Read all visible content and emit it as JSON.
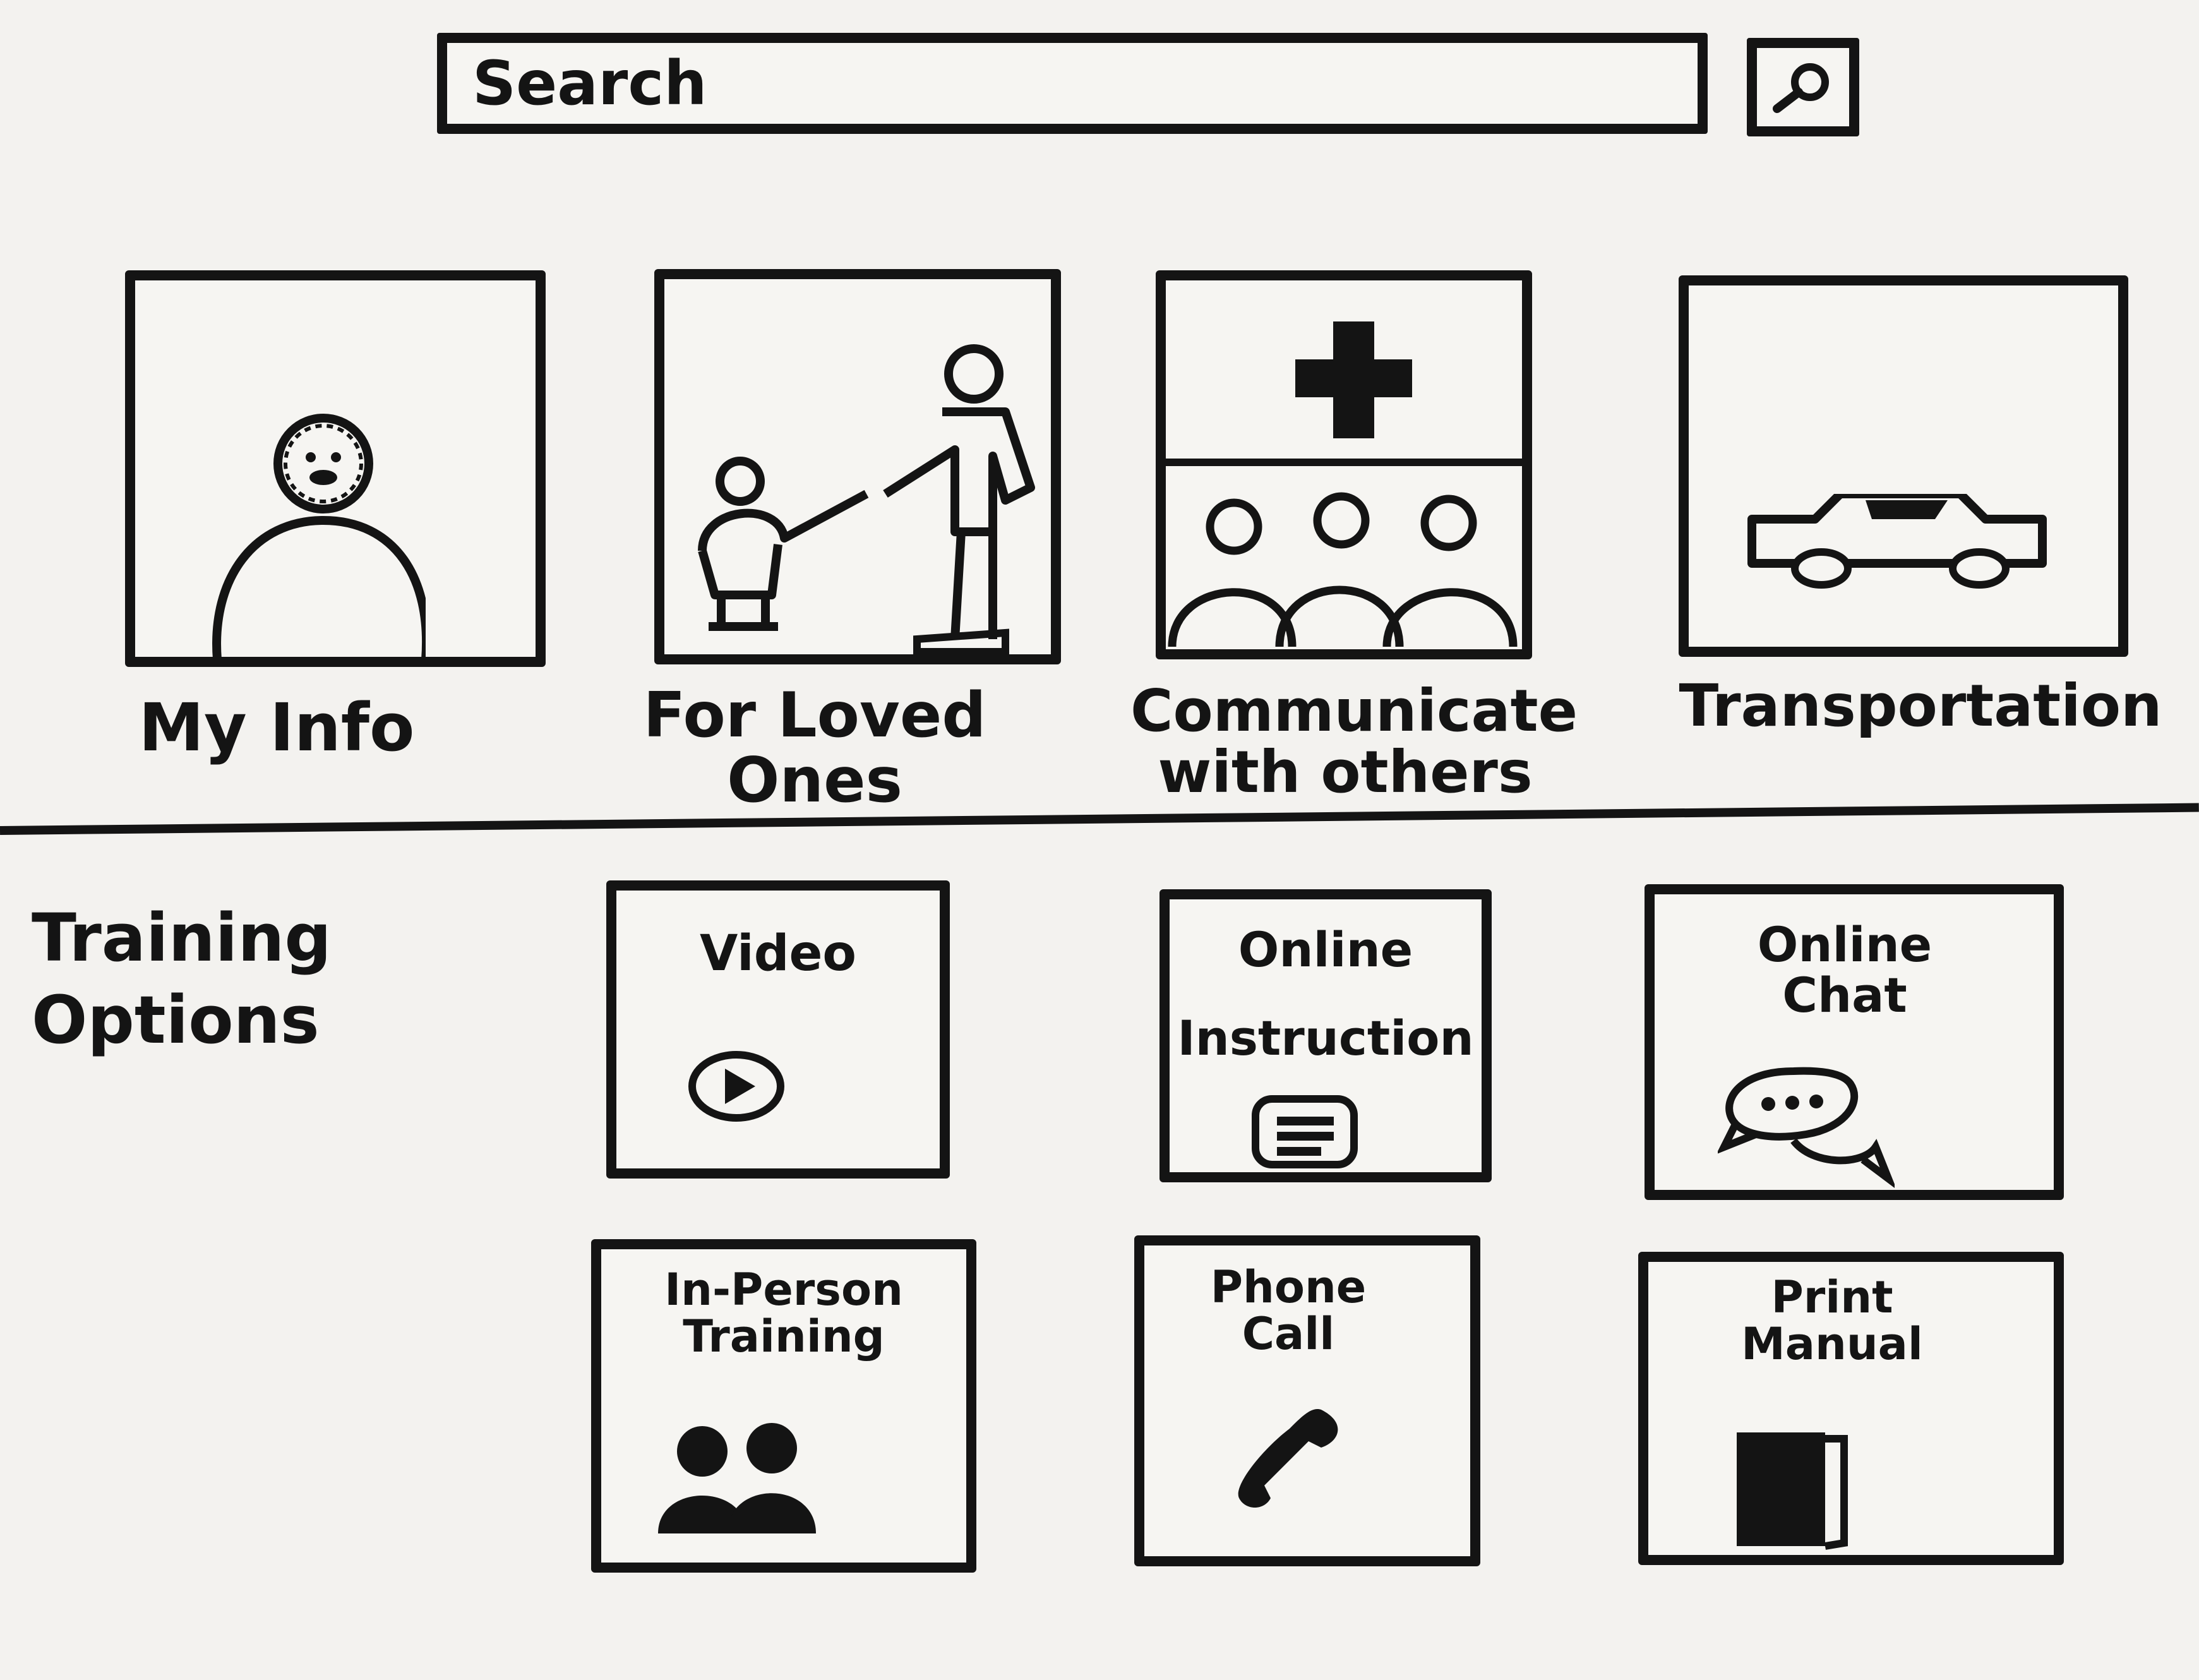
{
  "search": {
    "placeholder": "Search",
    "button_icon": "search-icon"
  },
  "categories": [
    {
      "label_line1": "My Info",
      "label_line2": "",
      "icon": "person-icon"
    },
    {
      "label_line1": "For Loved",
      "label_line2": "Ones",
      "icon": "adult-child-icon"
    },
    {
      "label_line1": "Communicate",
      "label_line2": "with others",
      "icon": "medical-cross-group-icon"
    },
    {
      "label_line1": "Transportation",
      "label_line2": "",
      "icon": "car-icon"
    }
  ],
  "training": {
    "section_title": "Training\nOptions",
    "options": [
      {
        "line1": "Video",
        "line2": "",
        "icon": "play-icon"
      },
      {
        "line1": "Online",
        "line2": "Instruction",
        "icon": "message-icon"
      },
      {
        "line1": "Online",
        "line2": "Chat",
        "icon": "chat-bubbles-icon"
      },
      {
        "line1": "In-Person",
        "line2": "Training",
        "icon": "people-icon"
      },
      {
        "line1": "Phone",
        "line2": "Call",
        "icon": "phone-icon"
      },
      {
        "line1": "Print",
        "line2": "Manual",
        "icon": "book-icon"
      }
    ]
  }
}
